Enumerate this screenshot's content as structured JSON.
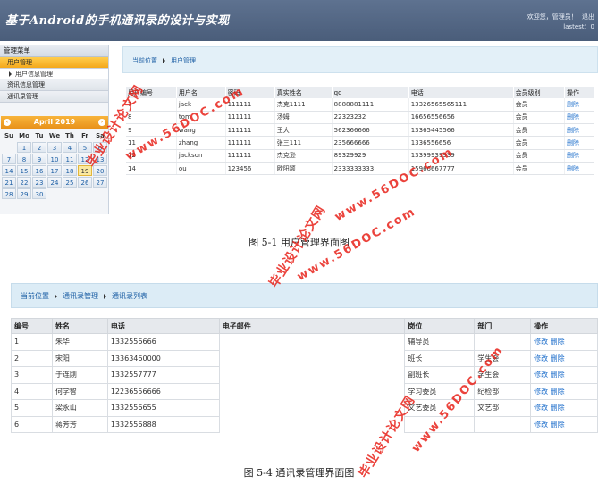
{
  "shot1": {
    "header": {
      "app_title": "基于Android的手机通讯录的设计与实现",
      "welcome": "欢迎您，管理员！",
      "logout": "退出",
      "last_login": "lastest：0"
    },
    "sidebar": {
      "heading": "管理菜单",
      "items": [
        {
          "label": "用户管理"
        },
        {
          "label": "用户信息管理"
        },
        {
          "label": "资讯信息管理"
        },
        {
          "label": "通讯录管理"
        }
      ]
    },
    "calendar": {
      "month_label": "April 2019",
      "prev_icon": "‹",
      "next_icon": "›",
      "weekdays": [
        "Su",
        "Mo",
        "Tu",
        "We",
        "Th",
        "Fr",
        "Sa"
      ],
      "today": "19"
    },
    "breadcrumb": {
      "root": "当前位置",
      "current": "用户管理"
    },
    "table": {
      "headers": [
        "用户编号",
        "用户名",
        "密码",
        "真实姓名",
        "qq",
        "电话",
        "会员级别",
        "操作"
      ],
      "rows": [
        [
          "7",
          "jack",
          "111111",
          "杰克1111",
          "8888881111",
          "13326565565111",
          "会员",
          "删除"
        ],
        [
          "8",
          "tom",
          "111111",
          "汤姆",
          "22323232",
          "16656556656",
          "会员",
          "删除"
        ],
        [
          "9",
          "wang",
          "111111",
          "王大",
          "562366666",
          "13365445566",
          "会员",
          "删除"
        ],
        [
          "11",
          "zhang",
          "111111",
          "张三111",
          "235666666",
          "1336556656",
          "会员",
          "删除"
        ],
        [
          "12",
          "jackson",
          "111111",
          "杰克逊",
          "89329929",
          "13399939939",
          "会员",
          "删除"
        ],
        [
          "14",
          "ou",
          "123456",
          "欧阳颖",
          "2333333333",
          "15966667777",
          "会员",
          "删除"
        ]
      ]
    },
    "caption": "图 5-1 用户管理界面图"
  },
  "shot2": {
    "breadcrumb": {
      "root": "当前位置",
      "middle": "通讯录管理",
      "current": "通讯录列表"
    },
    "table": {
      "headers": [
        "编号",
        "姓名",
        "电话",
        "电子邮件",
        "岗位",
        "部门",
        "操作"
      ],
      "rows": [
        [
          "1",
          "朱华",
          "1332556666",
          "",
          "辅导员",
          "",
          "修改 删除"
        ],
        [
          "2",
          "宋阳",
          "13363460000",
          "",
          "班长",
          "学生会",
          "修改 删除"
        ],
        [
          "3",
          "于连刚",
          "1332557777",
          "",
          "副班长",
          "学生会",
          "修改 删除"
        ],
        [
          "4",
          "何学智",
          "12236556666",
          "",
          "学习委员",
          "纪检部",
          "修改 删除"
        ],
        [
          "5",
          "梁永山",
          "1332556655",
          "",
          "文艺委员",
          "文艺部",
          "修改 删除"
        ],
        [
          "6",
          "蒋芳芳",
          "1332556888",
          "",
          "",
          "",
          "修改 删除"
        ]
      ]
    },
    "caption": "图 5-4 通讯录管理界面图"
  },
  "watermarks": {
    "cn": "毕业设计论文网",
    "url": "www.56DOC.com"
  }
}
